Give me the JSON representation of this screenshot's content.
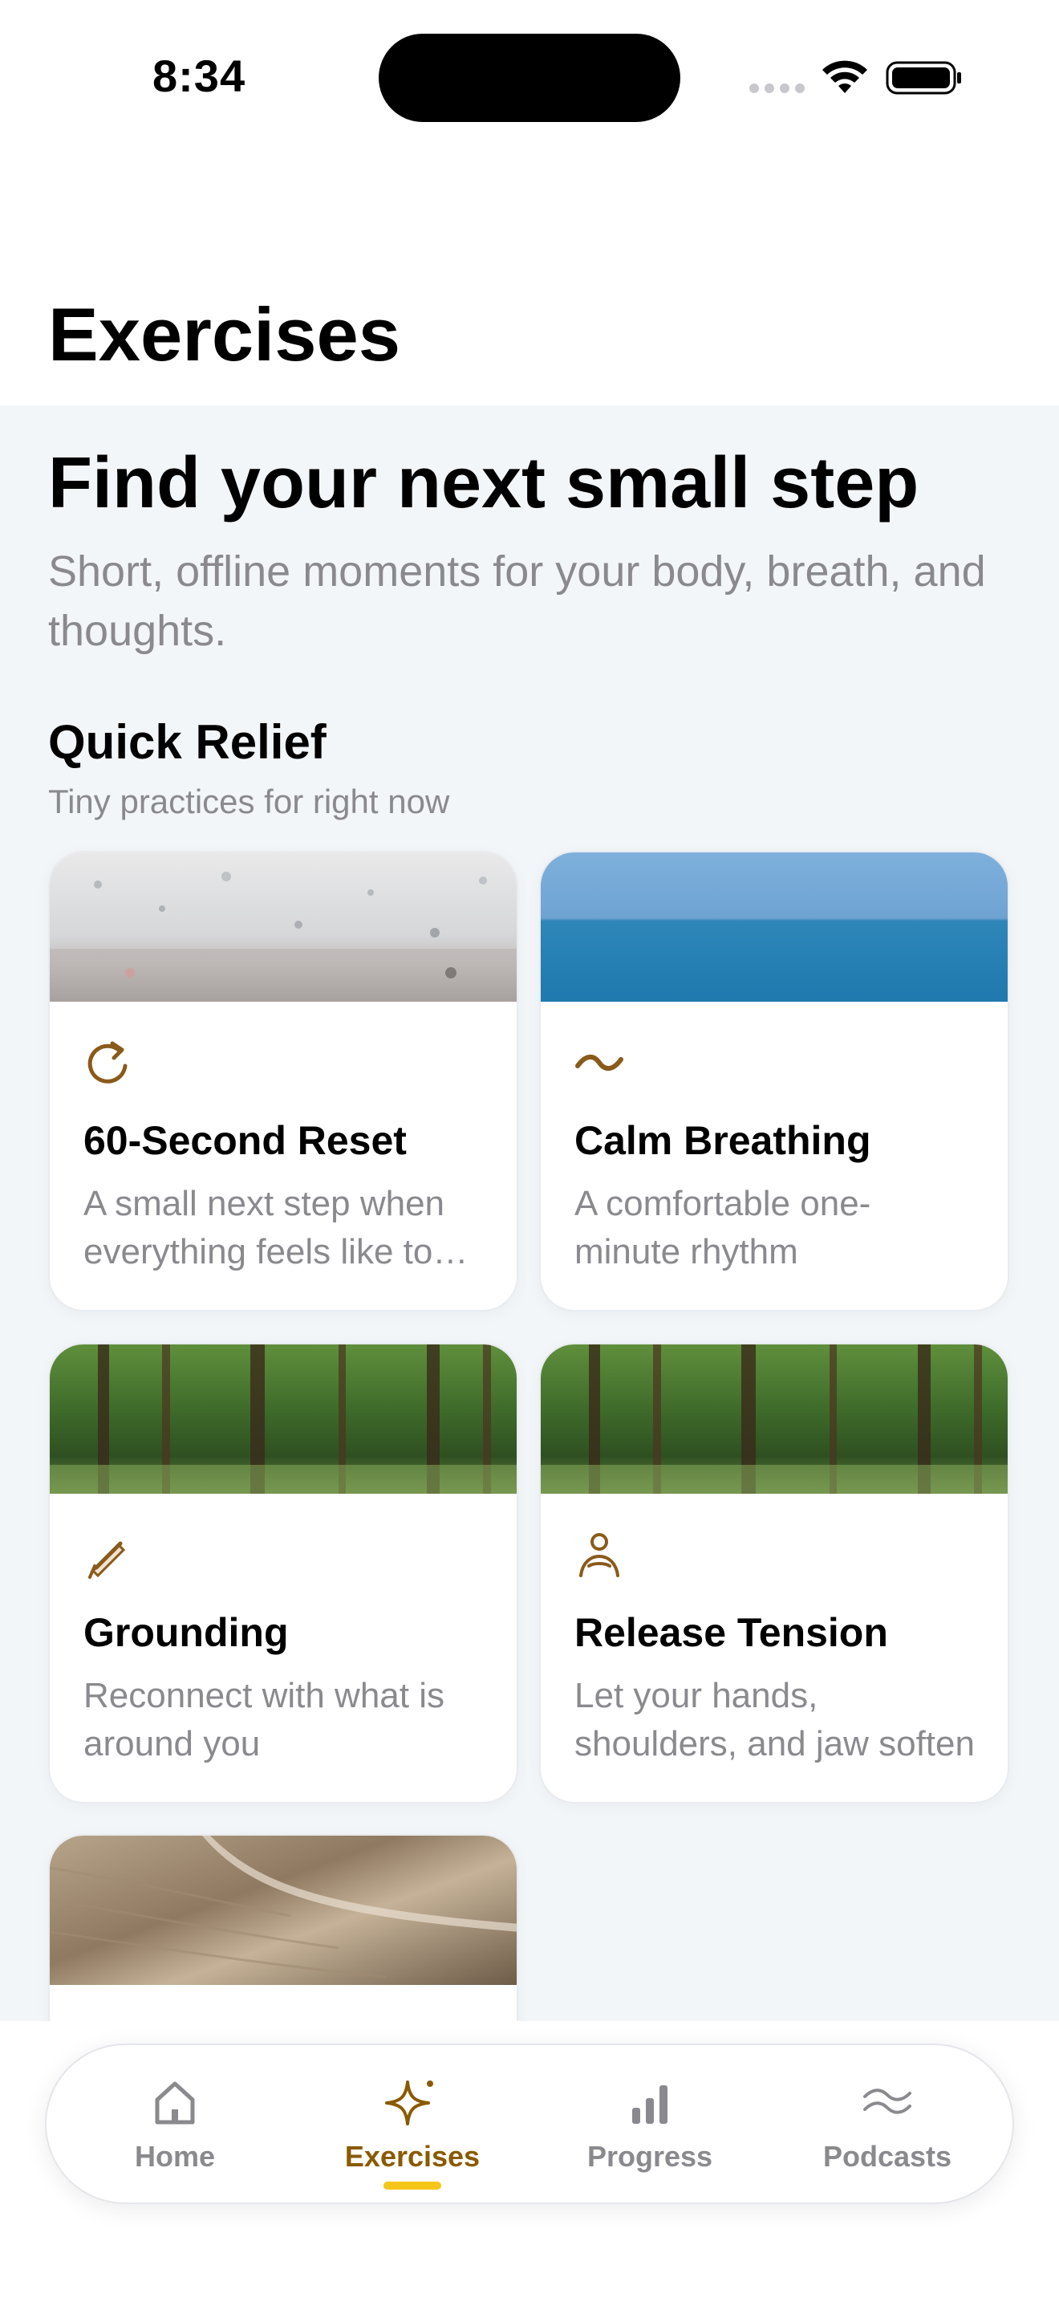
{
  "status_bar": {
    "time": "8:34"
  },
  "header": {
    "title": "Exercises"
  },
  "hero": {
    "title": "Find your next small step",
    "subtitle": "Short, offline moments for your body, breath, and thoughts."
  },
  "section": {
    "title": "Quick Relief",
    "subtitle": "Tiny practices for right now"
  },
  "cards": [
    {
      "title": "60-Second Reset",
      "description": "A small next step when everything feels like too much",
      "icon": "refresh-icon",
      "image": "rain-window"
    },
    {
      "title": "Calm Breathing",
      "description": "A comfortable one-minute rhythm",
      "icon": "wave-icon",
      "image": "ocean-horizon"
    },
    {
      "title": "Grounding",
      "description": "Reconnect with what is around you",
      "icon": "pen-icon",
      "image": "forest"
    },
    {
      "title": "Release Tension",
      "description": "Let your hands, shoulders, and jaw soften",
      "icon": "person-icon",
      "image": "forest"
    },
    {
      "title": "",
      "description": "",
      "icon": "",
      "image": "sand-dunes"
    }
  ],
  "tab_bar": {
    "tabs": [
      {
        "label": "Home",
        "icon": "home-icon",
        "active": false
      },
      {
        "label": "Exercises",
        "icon": "sparkle-icon",
        "active": true
      },
      {
        "label": "Progress",
        "icon": "bar-chart-icon",
        "active": false
      },
      {
        "label": "Podcasts",
        "icon": "waves-icon",
        "active": false
      }
    ]
  },
  "colors": {
    "accent": "#8a5a00",
    "indicator": "#f5c518",
    "icon_brown": "#8a5a1a",
    "secondary_text": "#8a8a8e",
    "content_background": "#f3f6f9"
  }
}
